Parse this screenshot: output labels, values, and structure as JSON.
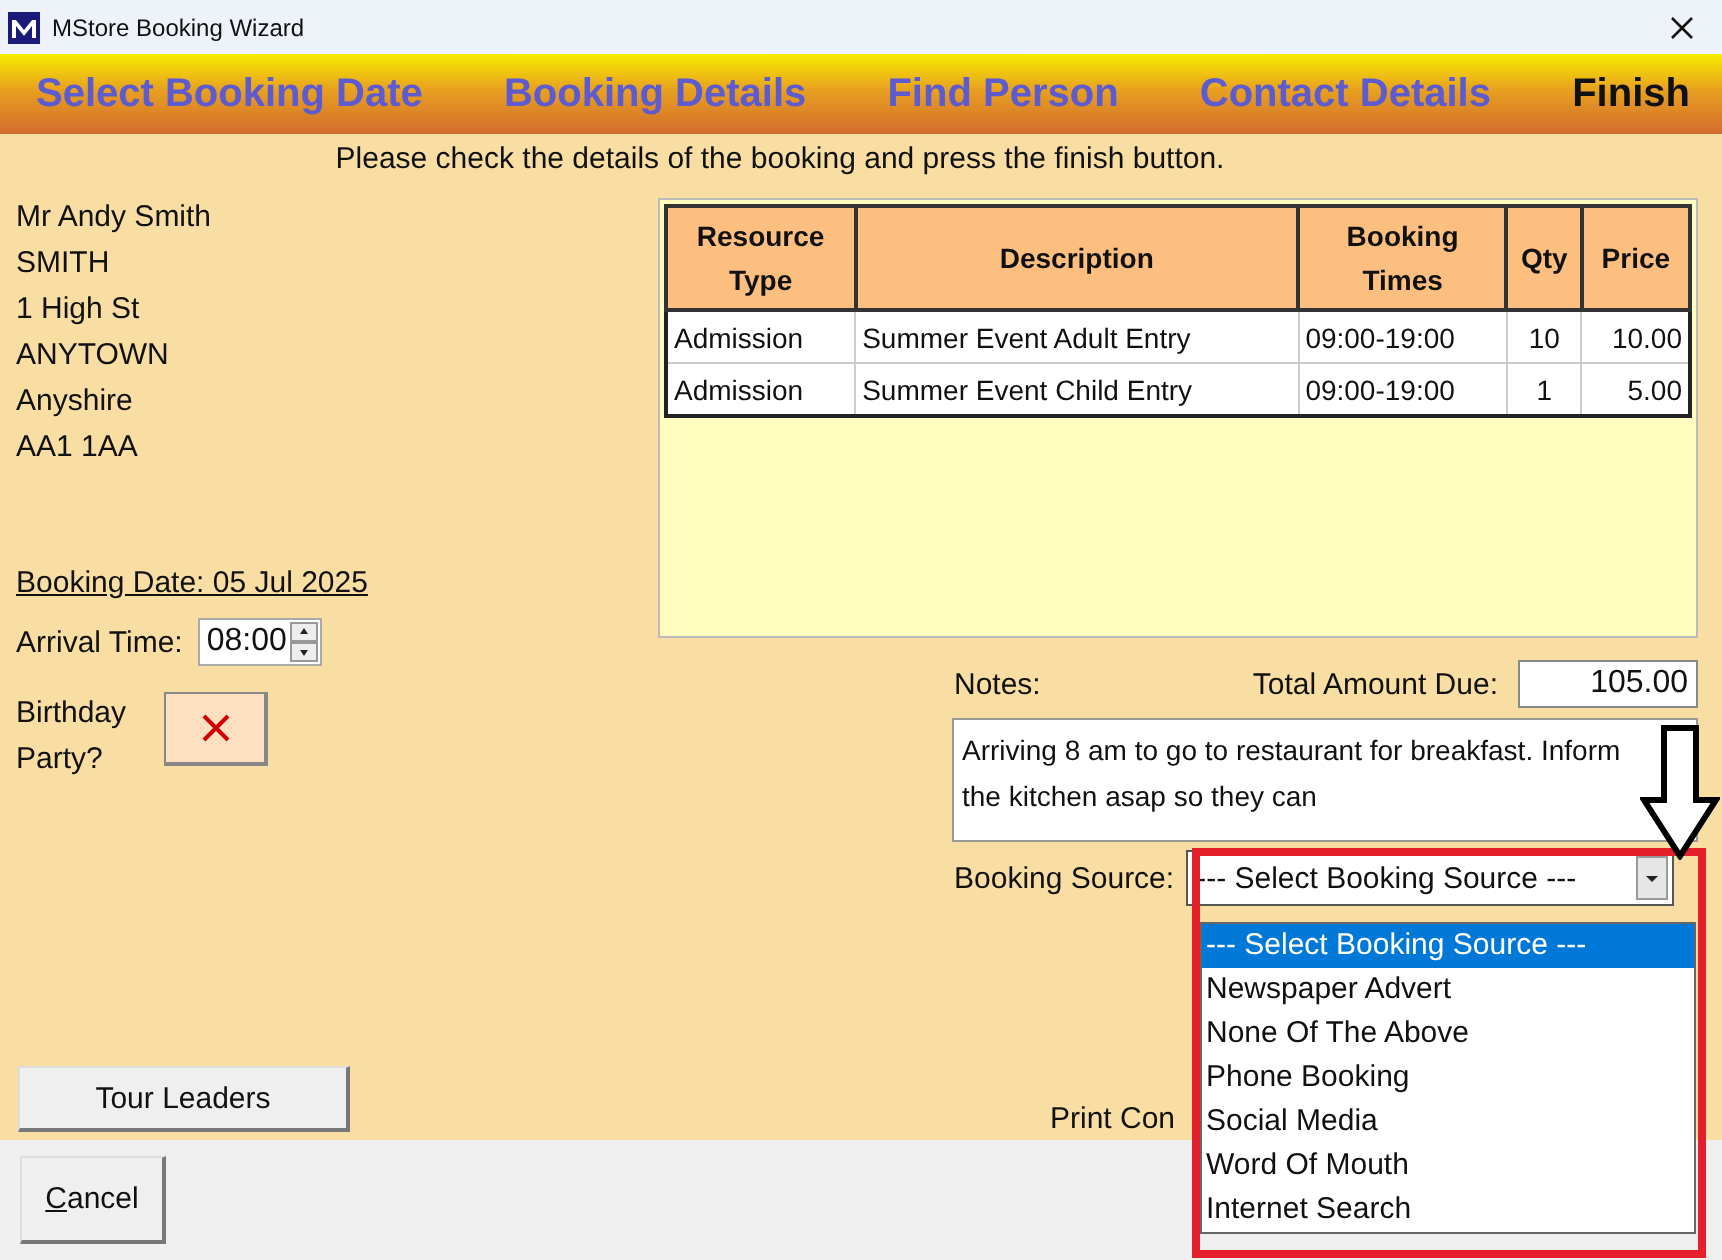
{
  "window": {
    "title": "MStore Booking Wizard"
  },
  "steps": [
    {
      "label": "Select Booking Date",
      "selected": false
    },
    {
      "label": "Booking Details",
      "selected": false
    },
    {
      "label": "Find Person",
      "selected": false
    },
    {
      "label": "Contact Details",
      "selected": false
    },
    {
      "label": "Finish",
      "selected": true
    }
  ],
  "instruction": "Please check the details of the booking and press the finish button.",
  "customer": {
    "lines": [
      "Mr Andy Smith",
      "SMITH",
      "1 High St",
      "ANYTOWN",
      "Anyshire",
      "AA1 1AA"
    ]
  },
  "booking_date": "Booking Date: 05 Jul 2025",
  "arrival": {
    "label": "Arrival Time:",
    "value": "08:00"
  },
  "birthday": {
    "label": "Birthday Party?",
    "checked": false
  },
  "table": {
    "columns": [
      "Resource Type",
      "Description",
      "Booking Times",
      "Qty",
      "Price"
    ],
    "rows": [
      [
        "Admission",
        "Summer Event Adult Entry",
        "09:00-19:00",
        "10",
        "10.00"
      ],
      [
        "Admission",
        "Summer Event Child Entry",
        "09:00-19:00",
        "1",
        "5.00"
      ]
    ]
  },
  "notes": {
    "label": "Notes:",
    "value": "Arriving 8 am to go to restaurant for breakfast. Inform the kitchen asap so they can"
  },
  "total": {
    "label": "Total Amount Due:",
    "value": "105.00"
  },
  "booking_source": {
    "label": "Booking Source:",
    "value": "--- Select Booking Source ---",
    "expanded": true,
    "options": [
      {
        "label": "--- Select Booking Source ---",
        "selected": true
      },
      {
        "label": "Newspaper Advert",
        "selected": false
      },
      {
        "label": "None Of The Above",
        "selected": false
      },
      {
        "label": "Phone Booking",
        "selected": false
      },
      {
        "label": "Social Media",
        "selected": false
      },
      {
        "label": "Word Of Mouth",
        "selected": false
      },
      {
        "label": "Internet Search",
        "selected": false
      }
    ]
  },
  "buttons": {
    "tour_leaders": "Tour Leaders",
    "print": "Print Con",
    "cancel": "Cancel"
  }
}
